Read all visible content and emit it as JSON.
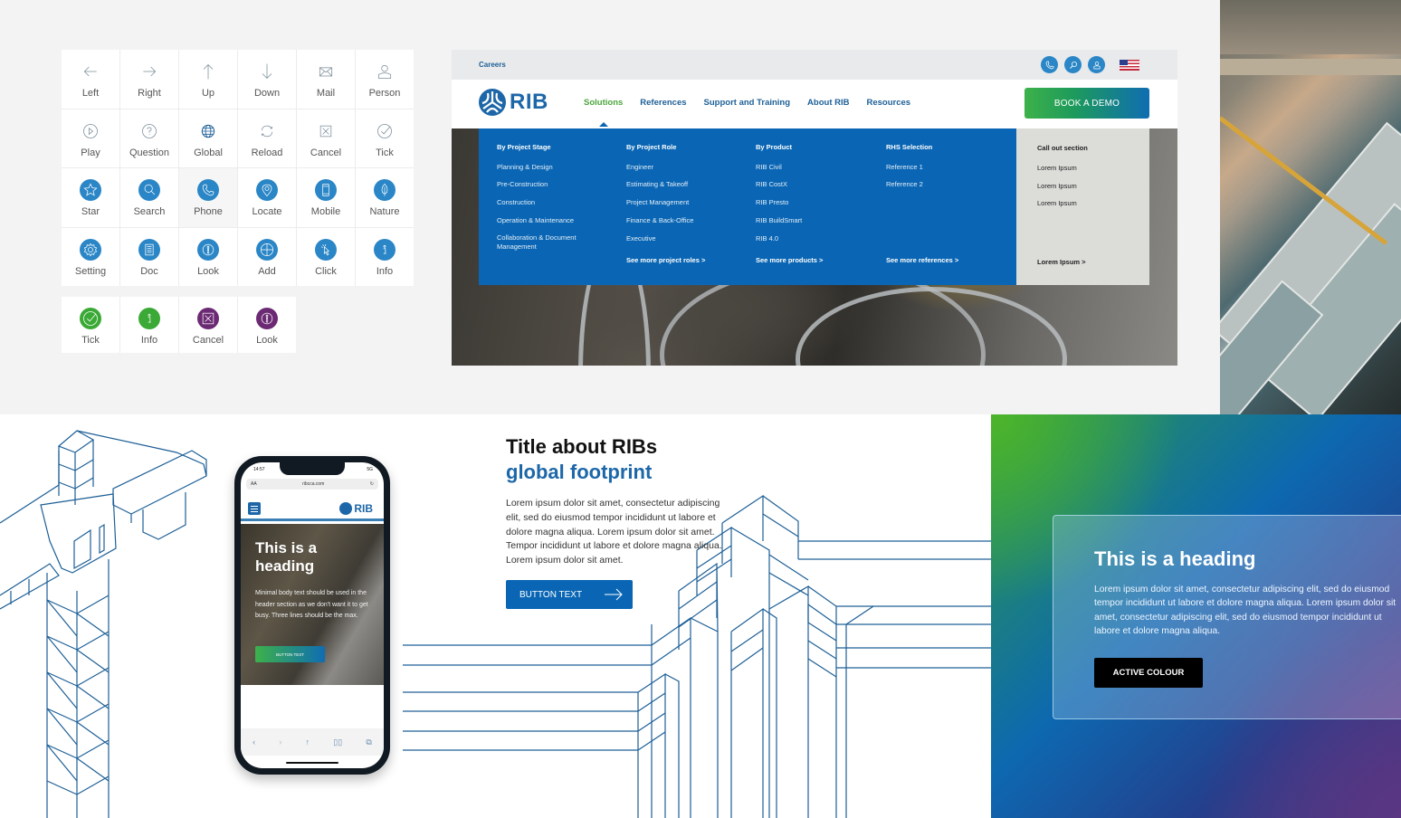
{
  "icon_library": {
    "grid": [
      {
        "label": "Left",
        "icon": "arrow-left-icon",
        "style": "outline"
      },
      {
        "label": "Right",
        "icon": "arrow-right-icon",
        "style": "outline"
      },
      {
        "label": "Up",
        "icon": "arrow-up-icon",
        "style": "outline"
      },
      {
        "label": "Down",
        "icon": "arrow-down-icon",
        "style": "outline"
      },
      {
        "label": "Mail",
        "icon": "mail-icon",
        "style": "outline"
      },
      {
        "label": "Person",
        "icon": "person-icon",
        "style": "outline"
      },
      {
        "label": "Play",
        "icon": "play-icon",
        "style": "outline"
      },
      {
        "label": "Question",
        "icon": "question-icon",
        "style": "outline"
      },
      {
        "label": "Global",
        "icon": "globe-icon",
        "style": "outline"
      },
      {
        "label": "Reload",
        "icon": "reload-icon",
        "style": "outline"
      },
      {
        "label": "Cancel",
        "icon": "cancel-icon",
        "style": "outline"
      },
      {
        "label": "Tick",
        "icon": "tick-icon",
        "style": "outline"
      },
      {
        "label": "Star",
        "icon": "star-icon",
        "style": "filled-blue"
      },
      {
        "label": "Search",
        "icon": "search-icon",
        "style": "filled-blue"
      },
      {
        "label": "Phone",
        "icon": "phone-icon",
        "style": "filled-blue",
        "highlighted": true
      },
      {
        "label": "Locate",
        "icon": "locate-icon",
        "style": "filled-blue"
      },
      {
        "label": "Mobile",
        "icon": "mobile-icon",
        "style": "filled-blue"
      },
      {
        "label": "Nature",
        "icon": "leaf-icon",
        "style": "filled-blue"
      },
      {
        "label": "Setting",
        "icon": "gear-icon",
        "style": "filled-blue"
      },
      {
        "label": "Doc",
        "icon": "document-icon",
        "style": "filled-blue"
      },
      {
        "label": "Look",
        "icon": "exclamation-icon",
        "style": "filled-blue"
      },
      {
        "label": "Add",
        "icon": "add-icon",
        "style": "filled-blue"
      },
      {
        "label": "Click",
        "icon": "pointer-icon",
        "style": "filled-blue"
      },
      {
        "label": "Info",
        "icon": "info-icon",
        "style": "filled-blue"
      }
    ],
    "status_grid": [
      {
        "label": "Tick",
        "icon": "tick-icon",
        "color": "#3aa935"
      },
      {
        "label": "Info",
        "icon": "info-icon",
        "color": "#3aa935"
      },
      {
        "label": "Cancel",
        "icon": "cancel-icon",
        "color": "#6b2a73"
      },
      {
        "label": "Look",
        "icon": "exclamation-icon",
        "color": "#6b2a73"
      }
    ]
  },
  "website": {
    "topbar": {
      "careers": "Careers",
      "icons": [
        "phone-icon",
        "search-icon",
        "person-icon"
      ],
      "flag": "us-flag-icon"
    },
    "logo_text": "RIB",
    "nav": [
      {
        "label": "Solutions",
        "active": true
      },
      {
        "label": "References",
        "active": false
      },
      {
        "label": "Support and Training",
        "active": false
      },
      {
        "label": "About RIB",
        "active": false
      },
      {
        "label": "Resources",
        "active": false
      }
    ],
    "cta": "BOOK A DEMO",
    "mega_menu": {
      "columns": [
        {
          "heading": "By Project Stage",
          "items": [
            "Planning & Design",
            "Pre-Construction",
            "Construction",
            "Operation & Maintenance",
            "Collaboration & Document Management"
          ],
          "more": ""
        },
        {
          "heading": "By Project Role",
          "items": [
            "Engineer",
            "Estimating & Takeoff",
            "Project Management",
            "Finance & Back-Office",
            "Executive"
          ],
          "more": "See more project roles >"
        },
        {
          "heading": "By Product",
          "items": [
            "RIB Civil",
            "RIB CostX",
            "RIB Presto",
            "RIB BuildSmart",
            "RIB 4.0"
          ],
          "more": "See more products >"
        },
        {
          "heading": "RHS Selection",
          "items": [
            "Reference 1",
            "Reference 2"
          ],
          "more": "See more references >"
        }
      ],
      "callout": {
        "heading": "Call out section",
        "items": [
          "Lorem Ipsum",
          "Lorem Ipsum",
          "Lorem Ipsum"
        ],
        "more": "Lorem Ipsum >"
      }
    }
  },
  "mobile": {
    "time": "14:57",
    "signal": "5G",
    "url_left": "AA",
    "url": "ribcca.com",
    "logo_text": "RIB",
    "heading": "This is a heading",
    "body": "Minimal body text should be used in the header section as we don't want it to get busy. Three lines should be the max.",
    "button": "BUTTON TEXT"
  },
  "feature": {
    "title_line1": "Title about RIBs",
    "title_line2": "global footprint",
    "body": "Lorem ipsum dolor sit amet, consectetur adipiscing elit, sed do eiusmod tempor incididunt ut labore et dolore magna aliqua. Lorem ipsum dolor sit amet. Tempor incididunt ut labore et dolore magna aliqua. Lorem ipsum dolor sit amet.",
    "button": "BUTTON TEXT"
  },
  "gradient_card": {
    "heading": "This is a heading",
    "body_lines": [
      "Lorem ipsum dolor sit amet, consectetur adipiscing elit, sed do eiusmod",
      "tempor incididunt ut labore et dolore magna aliqua. Lorem ipsum dolor sit",
      "amet, consectetur adipiscing elit, sed do eiusmod tempor incididunt ut",
      "labore et dolore magna aliqua."
    ],
    "button": "ACTIVE COLOUR"
  },
  "colors": {
    "brand_blue": "#0a66b4",
    "brand_green": "#3db14a",
    "purple": "#6b2a73",
    "icon_blue": "#2a86c6"
  }
}
